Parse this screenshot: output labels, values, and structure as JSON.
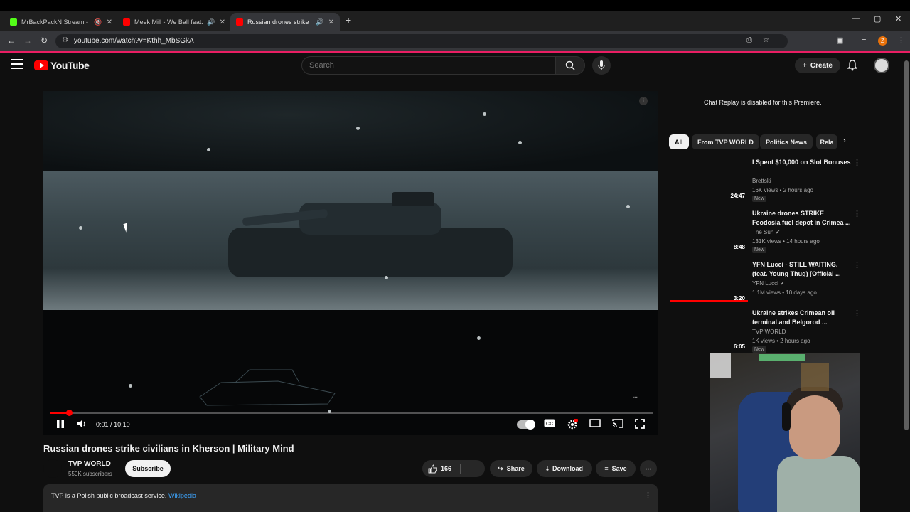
{
  "browser": {
    "tabs": [
      {
        "title": "MrBackPackN Stream - Wa",
        "fav_color": "#53fc18"
      },
      {
        "title": "Meek Mill - We Ball feat. Yo",
        "fav_color": "#ff0000"
      },
      {
        "title": "Russian drones strike civilia",
        "fav_color": "#ff0000"
      }
    ],
    "new_tab": "+",
    "url": "youtube.com/watch?v=Kthh_MbSGkA",
    "win_min": "—",
    "win_max": "▢",
    "win_close": "✕"
  },
  "youtube": {
    "logo_text": "YouTube",
    "search_placeholder": "Search",
    "create_label": "Create",
    "player": {
      "current_time": "0:01",
      "separator": "/",
      "duration": "10:10",
      "progress_fraction": 0.003
    },
    "video": {
      "title": "Russian drones strike civilians in Kherson | Military Mind",
      "channel": "TVP WORLD",
      "subscribers": "550K subscribers",
      "subscribe_label": "Subscribe",
      "likes": "166",
      "share_label": "Share",
      "download_label": "Download",
      "save_label": "Save",
      "description": "TVP is a Polish public broadcast service.",
      "description_link": "Wikipedia"
    },
    "chat_message": "Chat Replay is disabled for this Premiere.",
    "chips": [
      "All",
      "From TVP WORLD",
      "Politics News",
      "Rela"
    ],
    "recommendations": [
      {
        "title": "I Spent $10,000 on Slot Bonuses",
        "channel": "Brettski",
        "meta": "16K views • 2 hours ago",
        "badge": "New",
        "duration": "24:47"
      },
      {
        "title": "Ukraine drones STRIKE Feodosia fuel depot in Crimea ...",
        "channel": "The Sun",
        "meta": "131K views • 14 hours ago",
        "badge": "New",
        "duration": "8:48"
      },
      {
        "title": "YFN Lucci - STILL WAITING. (feat. Young Thug) [Official ...",
        "channel": "YFN Lucci",
        "meta": "1.1M views • 10 days ago",
        "badge": "",
        "duration": "3:20"
      },
      {
        "title": "Ukraine strikes Crimean oil terminal and Belgorod ...",
        "channel": "TVP WORLD",
        "meta": "1K views • 2 hours ago",
        "badge": "New",
        "duration": "6:05"
      }
    ]
  },
  "colors": {
    "accent": "#ff0000",
    "link": "#3ea6ff",
    "bg": "#0f0f0f"
  }
}
